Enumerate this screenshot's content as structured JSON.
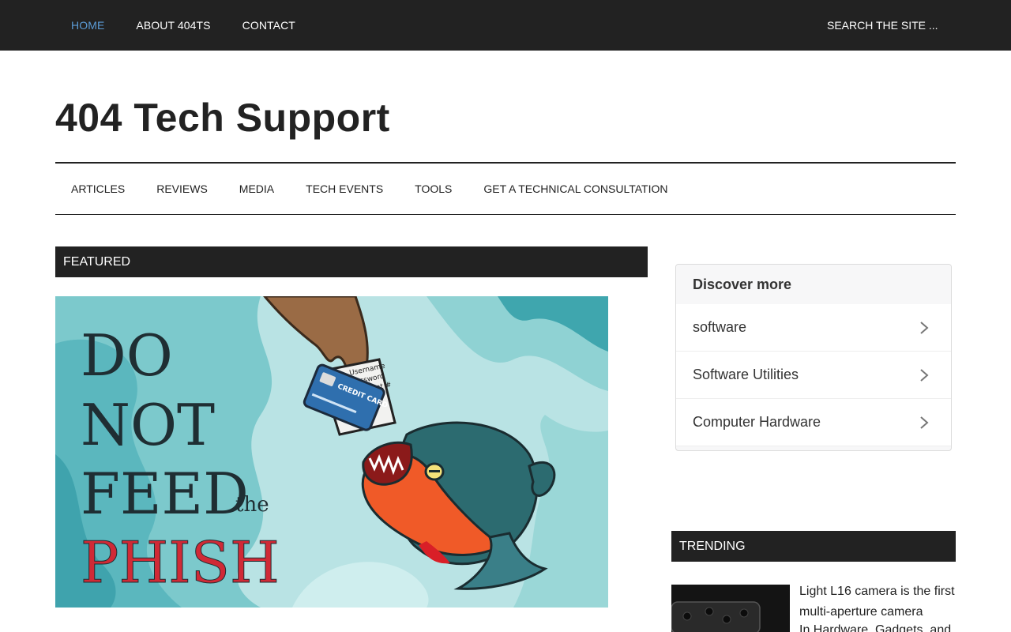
{
  "topnav": {
    "items": [
      {
        "label": "HOME",
        "active": true
      },
      {
        "label": "ABOUT 404TS",
        "active": false
      },
      {
        "label": "CONTACT",
        "active": false
      }
    ],
    "search_label": "SEARCH THE SITE ..."
  },
  "site": {
    "title": "404 Tech Support"
  },
  "mainnav": {
    "items": [
      "ARTICLES",
      "REVIEWS",
      "MEDIA",
      "TECH EVENTS",
      "TOOLS",
      "GET A TECHNICAL CONSULTATION"
    ]
  },
  "featured": {
    "heading": "FEATURED",
    "image_text": {
      "line1": "DO",
      "line2": "NOT",
      "line3": "FEED",
      "line3_small": "the",
      "line4": "PHISH"
    },
    "card_text": "CREDIT CARD",
    "note_lines": [
      "Username",
      "Password",
      "Account #"
    ]
  },
  "discover": {
    "title": "Discover more",
    "items": [
      "software",
      "Software Utilities",
      "Computer Hardware"
    ]
  },
  "trending": {
    "heading": "TRENDING",
    "item_title": "Light L16 camera is the first multi-aperture camera",
    "item_meta": "In Hardware, Gadgets, and"
  },
  "colors": {
    "topbar": "#222222",
    "active_link": "#5b9bd5",
    "phish_red": "#d02a36",
    "water": "#58b8c0"
  }
}
